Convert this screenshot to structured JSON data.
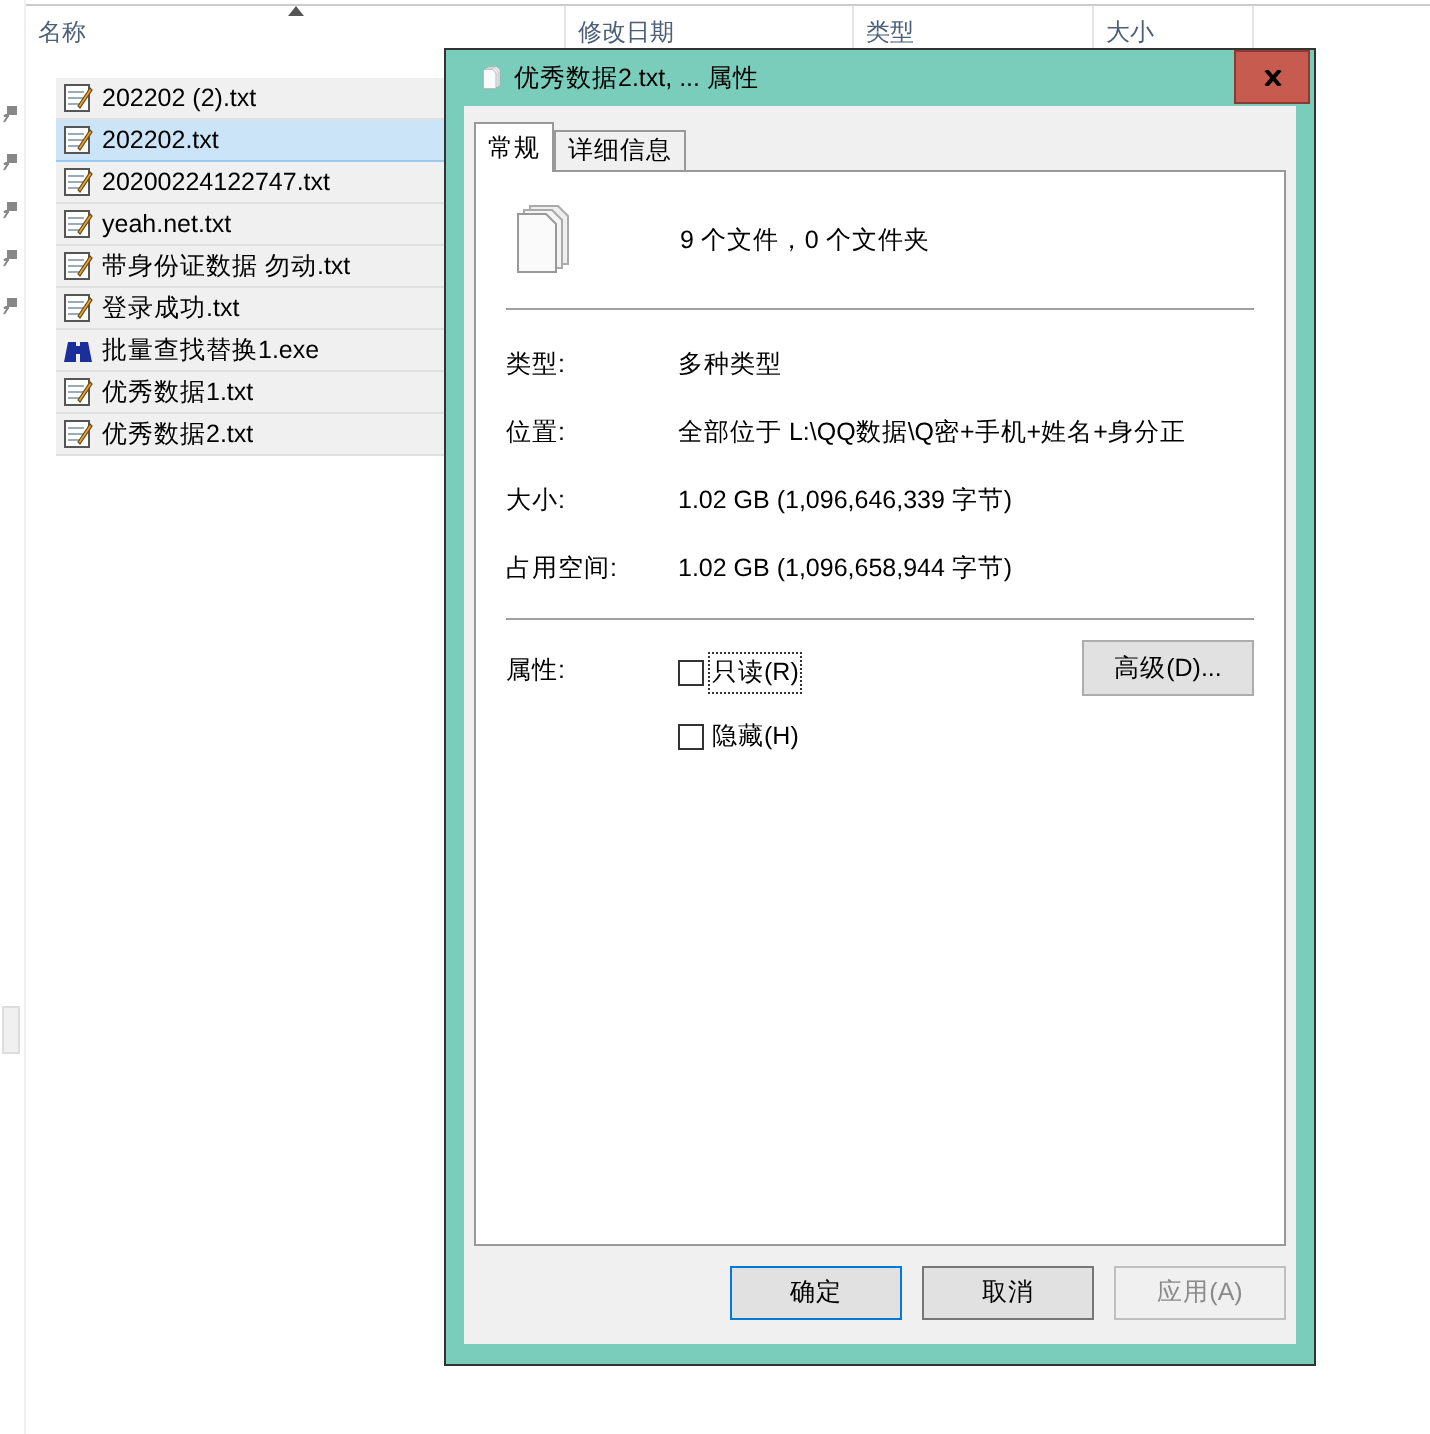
{
  "explorer": {
    "columns": [
      {
        "label": "名称",
        "sorted": true
      },
      {
        "label": "修改日期",
        "sorted": false
      },
      {
        "label": "类型",
        "sorted": false
      },
      {
        "label": "大小",
        "sorted": false
      }
    ],
    "rows": [
      {
        "name": "202202 (2).txt",
        "kind": "text",
        "selected": false
      },
      {
        "name": "202202.txt",
        "kind": "text",
        "selected": true
      },
      {
        "name": "20200224122747.txt",
        "kind": "text",
        "selected": false
      },
      {
        "name": "yeah.net.txt",
        "kind": "text",
        "selected": false
      },
      {
        "name": "带身份证数据 勿动.txt",
        "kind": "text",
        "selected": false
      },
      {
        "name": "登录成功.txt",
        "kind": "text",
        "selected": false
      },
      {
        "name": "批量查找替换1.exe",
        "kind": "program",
        "selected": false
      },
      {
        "name": "优秀数据1.txt",
        "kind": "text",
        "selected": false
      },
      {
        "name": "优秀数据2.txt",
        "kind": "text",
        "selected": false
      }
    ]
  },
  "dialog": {
    "title": "优秀数据2.txt, ... 属性",
    "tabs": [
      {
        "label": "常规",
        "selected": true
      },
      {
        "label": "详细信息",
        "selected": false
      }
    ],
    "summary": "9 个文件，0 个文件夹",
    "fields": [
      {
        "label": "类型:",
        "value": "多种类型"
      },
      {
        "label": "位置:",
        "value": "全部位于 L:\\QQ数据\\Q密+手机+姓名+身分正"
      },
      {
        "label": "大小:",
        "value": "1.02 GB (1,096,646,339 字节)"
      },
      {
        "label": "占用空间:",
        "value": "1.02 GB (1,096,658,944 字节)"
      }
    ],
    "attributes": {
      "label": "属性:",
      "checkboxes": [
        {
          "label": "只读(R)",
          "checked": false,
          "focused": true
        },
        {
          "label": "隐藏(H)",
          "checked": false,
          "focused": false
        }
      ],
      "advanced": "高级(D)..."
    },
    "buttons": [
      {
        "label": "确定",
        "default": true,
        "disabled": false
      },
      {
        "label": "取消",
        "default": false,
        "disabled": false
      },
      {
        "label": "应用(A)",
        "default": false,
        "disabled": true
      }
    ]
  }
}
